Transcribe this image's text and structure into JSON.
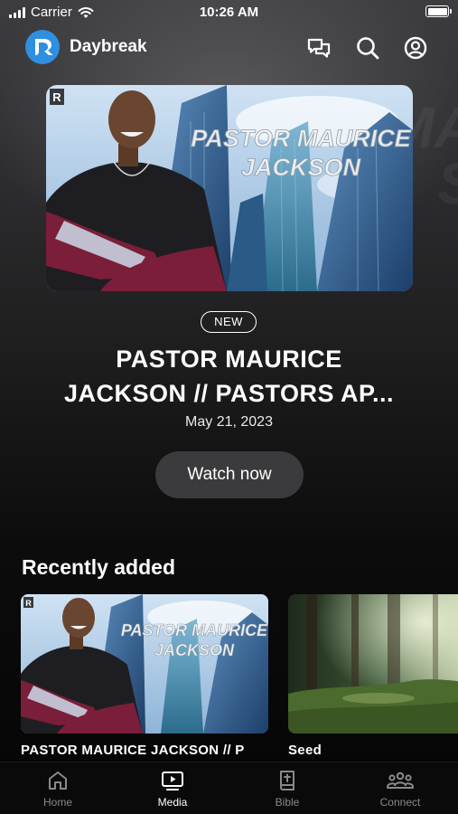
{
  "status_bar": {
    "carrier": "Carrier",
    "time": "10:26 AM"
  },
  "header": {
    "brand": "Daybreak",
    "icons": [
      "chat-icon",
      "search-icon",
      "account-icon"
    ]
  },
  "featured": {
    "thumbnail_text_line1": "PASTOR MAURICE",
    "thumbnail_text_line2": "JACKSON",
    "badge": "NEW",
    "title_line1": "PASTOR  MAURICE",
    "title_line2": "JACKSON // PASTORS AP...",
    "date": "May 21, 2023",
    "button_label": "Watch now"
  },
  "recently_added": {
    "heading": "Recently added",
    "items": [
      {
        "label": "PASTOR  MAURICE JACKSON // P",
        "thumbnail_text_line1": "PASTOR MAURICE",
        "thumbnail_text_line2": "JACKSON"
      },
      {
        "label": "Seed"
      }
    ]
  },
  "tab_bar": {
    "tabs": [
      {
        "label": "Home",
        "icon": "home-icon",
        "active": false
      },
      {
        "label": "Media",
        "icon": "media-icon",
        "active": true
      },
      {
        "label": "Bible",
        "icon": "bible-icon",
        "active": false
      },
      {
        "label": "Connect",
        "icon": "connect-icon",
        "active": false
      }
    ]
  },
  "colors": {
    "brand_accent": "#2f8fe0",
    "button_bg": "#3b3b3d",
    "active_tab": "#ffffff",
    "inactive_tab": "#8a8a8a"
  }
}
